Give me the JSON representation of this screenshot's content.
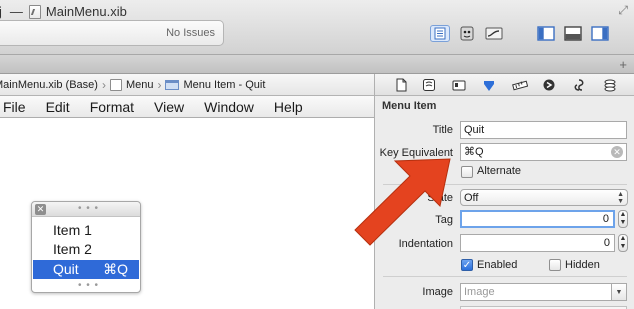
{
  "window": {
    "title_fragment": "j",
    "separator": "—",
    "document_name": "MainMenu.xib",
    "status": "No Issues"
  },
  "toolbar": {
    "editor_buttons": [
      "standard-editor-icon",
      "assistant-editor-icon",
      "version-editor-icon"
    ],
    "view_buttons": [
      "navigator-toggle-icon",
      "debug-area-toggle-icon",
      "utilities-toggle-icon"
    ],
    "active_editor": "standard"
  },
  "jumpbar": {
    "crumbs": [
      "MainMenu.xib (Base)",
      "Menu",
      "Menu Item - Quit"
    ]
  },
  "app_menu": {
    "items": [
      "File",
      "Edit",
      "Format",
      "View",
      "Window",
      "Help"
    ]
  },
  "menu_object": {
    "grip": "• • •",
    "items": [
      {
        "label": "Item 1",
        "shortcut": ""
      },
      {
        "label": "Item 2",
        "shortcut": ""
      },
      {
        "label": "Quit",
        "shortcut": "⌘Q",
        "selected": true
      }
    ]
  },
  "inspector": {
    "tabs": [
      "file-icon",
      "quick-help-icon",
      "identity-icon",
      "attributes-icon",
      "size-icon",
      "connections-icon",
      "bindings-icon",
      "effects-icon"
    ],
    "active_tab": "attributes-icon",
    "section": "Menu Item",
    "title_label": "Title",
    "title_value": "Quit",
    "key_label": "Key Equivalent",
    "key_value": "⌘Q",
    "alternate_label": "Alternate",
    "alternate_checked": false,
    "state_label": "State",
    "state_value": "Off",
    "tag_label": "Tag",
    "tag_value": "0",
    "indentation_label": "Indentation",
    "indentation_value": "0",
    "enabled_label": "Enabled",
    "enabled_checked": true,
    "hidden_label": "Hidden",
    "hidden_checked": false,
    "image_label": "Image",
    "image_placeholder": "Image"
  },
  "colors": {
    "selection": "#2f6ad8",
    "arrow": "#e4431f",
    "focus_ring": "#6da3ea"
  }
}
